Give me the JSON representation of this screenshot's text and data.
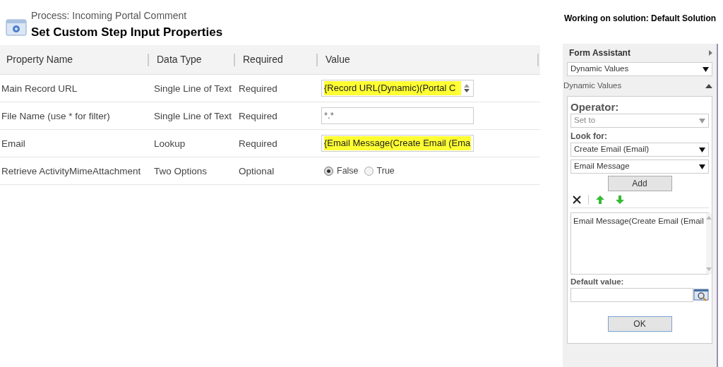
{
  "header": {
    "process": "Process: Incoming Portal Comment",
    "title": "Set Custom Step Input Properties",
    "solution": "Working on solution: Default Solution"
  },
  "table": {
    "columns": [
      "Property Name",
      "Data Type",
      "Required",
      "Value"
    ],
    "rows": [
      {
        "name": "Main Record URL",
        "type": "Single Line of Text",
        "required": "Required",
        "kind": "dynamic",
        "value": "{Record URL(Dynamic)(Portal C",
        "spinner": true
      },
      {
        "name": "File Name (use * for filter)",
        "type": "Single Line of Text",
        "required": "Required",
        "kind": "text",
        "value": "*.*"
      },
      {
        "name": "Email",
        "type": "Lookup",
        "required": "Required",
        "kind": "dynamic",
        "value": "{Email Message(Create Email (Ema"
      },
      {
        "name": "Retrieve ActivityMimeAttachment",
        "type": "Two Options",
        "required": "Optional",
        "kind": "radio",
        "options": [
          {
            "label": "False",
            "selected": true
          },
          {
            "label": "True",
            "selected": false
          }
        ]
      }
    ]
  },
  "form_assistant": {
    "title": "Form Assistant",
    "mode": "Dynamic Values",
    "section": "Dynamic Values",
    "operator_label": "Operator:",
    "operator": "Set to",
    "look_for_label": "Look for:",
    "look_for": "Create Email (Email)",
    "field": "Email Message",
    "add_button": "Add",
    "list_items": [
      "Email Message(Create Email (Email"
    ],
    "default_label": "Default value:",
    "ok_button": "OK"
  }
}
